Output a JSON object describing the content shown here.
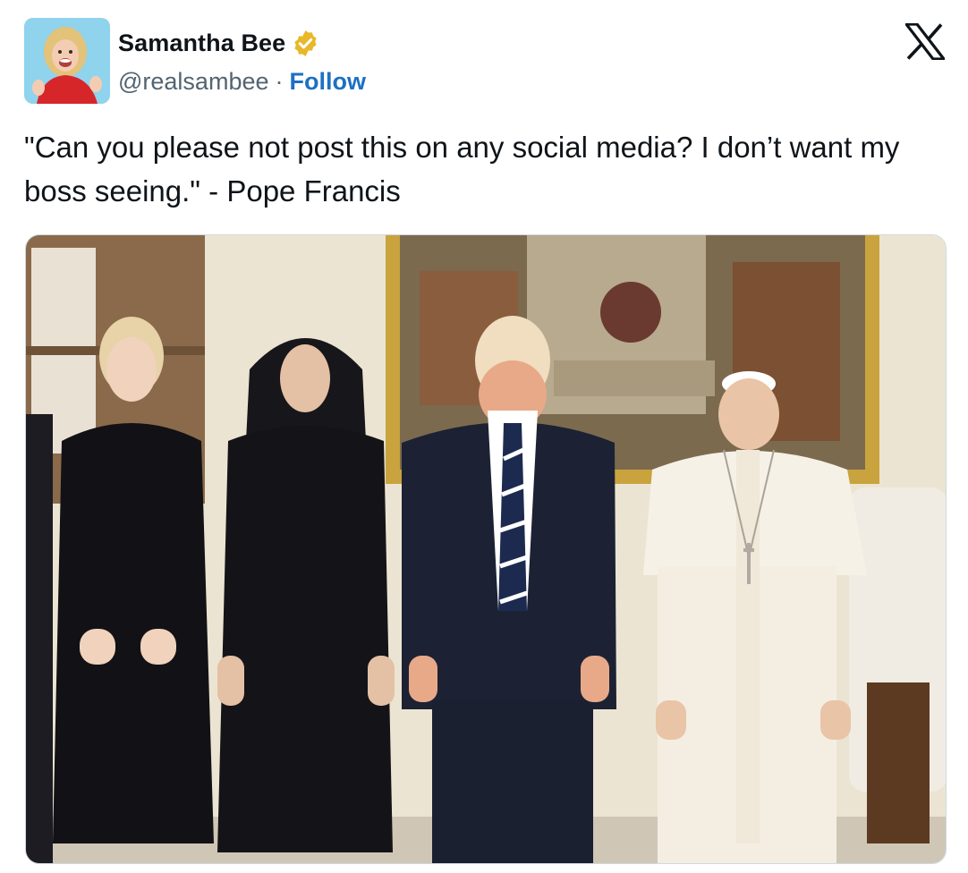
{
  "author": {
    "display_name": "Samantha Bee",
    "handle": "@realsambee",
    "separator": "·",
    "follow_label": "Follow",
    "verified_icon": "verified-badge-icon",
    "verified_color": "#e8b829"
  },
  "platform": {
    "logo_icon": "x-logo-icon"
  },
  "tweet": {
    "text": "\"Can you please not post this on any social media? I don’t want my boss seeing.\" - Pope Francis"
  },
  "colors": {
    "follow": "#1d70c4",
    "handle": "#536471",
    "text": "#0f1419"
  }
}
